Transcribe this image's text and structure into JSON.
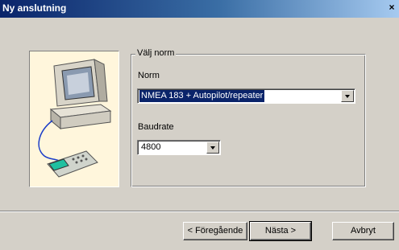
{
  "window": {
    "title": "Ny anslutning",
    "close_glyph": "×"
  },
  "group": {
    "legend": "Välj norm"
  },
  "norm": {
    "label": "Norm",
    "selected": "NMEA 183 + Autopilot/repeater"
  },
  "baudrate": {
    "label": "Baudrate",
    "selected": "4800"
  },
  "buttons": {
    "back": "< Föregående",
    "next": "Nästa >",
    "cancel": "Avbryt"
  },
  "illustration": {
    "icon": "computer-with-gps-device-icon"
  }
}
